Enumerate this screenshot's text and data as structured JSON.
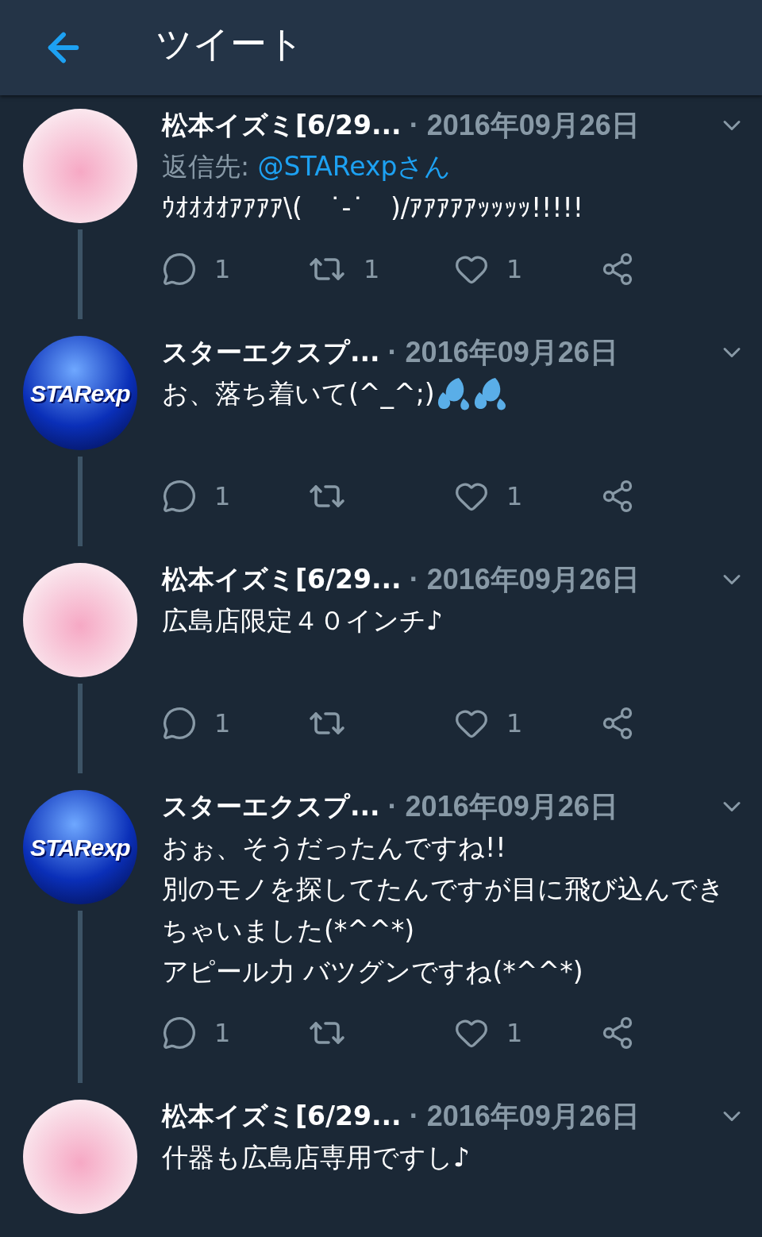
{
  "header": {
    "title": "ツイート"
  },
  "tweets": [
    {
      "avatar": {
        "kind": "anime"
      },
      "name": "松本イズミ[6/29...",
      "date": "· 2016年09月26日",
      "reply_to": {
        "prefix": "返信先: ",
        "handle": "@STARexpさん"
      },
      "body": "ｳｵｵｵｵｱｱｱｱ\\(　˙-˙　)/ｱｱｱｱｱｯｯｯｯ!!!!!",
      "replies": "1",
      "retweets": "1",
      "likes": "1"
    },
    {
      "avatar": {
        "kind": "logo",
        "label": "STARexp"
      },
      "name": "スターエクスプ...",
      "date": "· 2016年09月26日",
      "body": "お、落ち着いて(^_^;)",
      "emoji": [
        {
          "kind": "sweat-droplets"
        },
        {
          "kind": "sweat-droplets"
        }
      ],
      "replies": "1",
      "likes": "1"
    },
    {
      "avatar": {
        "kind": "anime"
      },
      "name": "松本イズミ[6/29...",
      "date": "· 2016年09月26日",
      "body": "広島店限定４０インチ♪",
      "replies": "1",
      "likes": "1"
    },
    {
      "avatar": {
        "kind": "logo",
        "label": "STARexp"
      },
      "name": "スターエクスプ...",
      "date": "· 2016年09月26日",
      "body": "おぉ、そうだったんですね!!\n別のモノを探してたんですが目に飛び込んできちゃいました(*^^*)\nアピール力 バツグンですね(*^^*)",
      "replies": "1",
      "likes": "1"
    },
    {
      "avatar": {
        "kind": "anime"
      },
      "name": "松本イズミ[6/29...",
      "date": "· 2016年09月26日",
      "body": "什器も広島店専用ですし♪"
    }
  ]
}
